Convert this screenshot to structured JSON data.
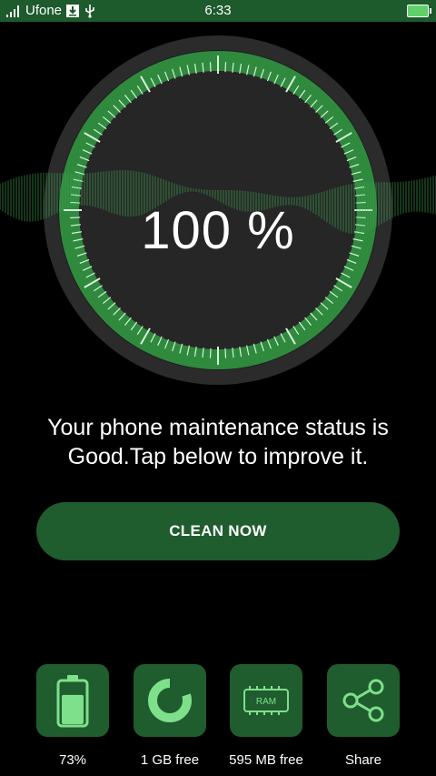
{
  "status_bar": {
    "carrier": "Ufone",
    "time": "6:33"
  },
  "gauge": {
    "percent_text": "100 %"
  },
  "message": "Your phone maintenance status is Good.Tap below to improve it.",
  "clean_button": {
    "label": "CLEAN NOW"
  },
  "tools": [
    {
      "name": "battery",
      "icon": "battery-icon",
      "label": "73%",
      "level": 0.73
    },
    {
      "name": "storage",
      "icon": "storage-ring-icon",
      "label": "1 GB free"
    },
    {
      "name": "ram",
      "icon": "ram-chip-icon",
      "label": "595 MB free",
      "chip_text": "RAM"
    },
    {
      "name": "share",
      "icon": "share-icon",
      "label": "Share"
    }
  ],
  "colors": {
    "accent": "#1f5c2e",
    "ring": "#2f8a3e",
    "dial": "#2a2a2a",
    "status_bar": "#1d5a2c"
  }
}
